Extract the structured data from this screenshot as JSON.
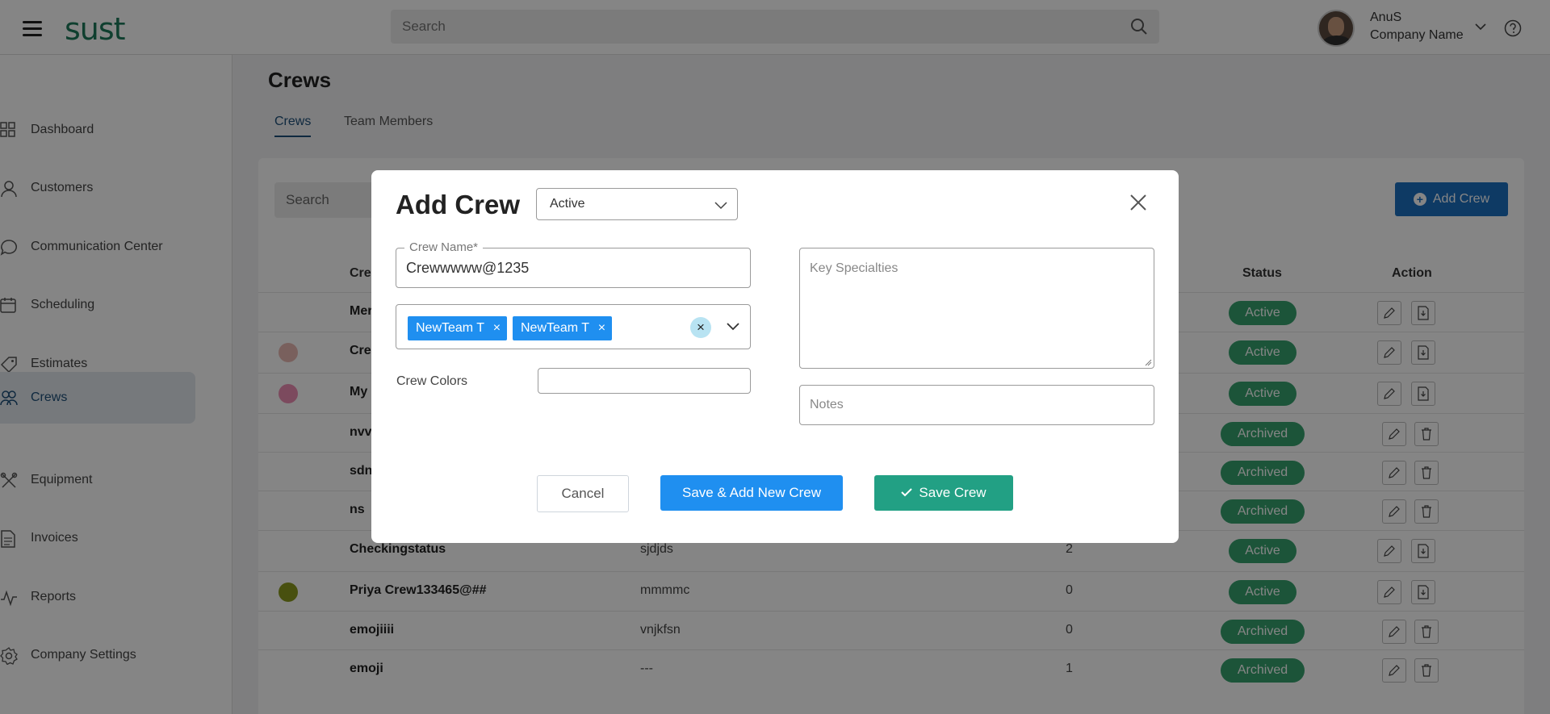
{
  "app": {
    "logo_text": "sust",
    "search_placeholder": "Search",
    "user_name": "AnuS",
    "company_name": "Company Name"
  },
  "sidebar": {
    "items": [
      {
        "label": "Dashboard",
        "icon": "dashboard-icon"
      },
      {
        "label": "Customers",
        "icon": "user-icon"
      },
      {
        "label": "Communication Center",
        "icon": "chat-icon"
      },
      {
        "label": "Scheduling",
        "icon": "calendar-icon"
      },
      {
        "label": "Estimates",
        "icon": "tag-icon"
      },
      {
        "label": "Crews",
        "icon": "crews-icon",
        "active": true
      },
      {
        "label": "Equipment",
        "icon": "tools-icon"
      },
      {
        "label": "Invoices",
        "icon": "document-icon"
      },
      {
        "label": "Reports",
        "icon": "chart-icon"
      },
      {
        "label": "Company Settings",
        "icon": "gear-icon"
      }
    ]
  },
  "main": {
    "title": "Crews",
    "tabs": [
      "Crews",
      "Team Members"
    ],
    "search_placeholder": "Search",
    "add_button_label": "Add Crew",
    "columns": {
      "name": "Cre",
      "status": "Status",
      "action": "Action"
    },
    "rows": [
      {
        "name": "Mer",
        "desc": "",
        "count": "",
        "status": "Active",
        "color": ""
      },
      {
        "name": "Cre",
        "desc": "",
        "count": "",
        "status": "Active",
        "color": "#e8b9b2"
      },
      {
        "name": "My",
        "desc": "",
        "count": "",
        "status": "Active",
        "color": "#ee8fb4"
      },
      {
        "name": "nvv",
        "desc": "",
        "count": "",
        "status": "Archived",
        "color": ""
      },
      {
        "name": "sdn",
        "desc": "",
        "count": "",
        "status": "Archived",
        "color": ""
      },
      {
        "name": "ns",
        "desc": "",
        "count": "",
        "status": "Archived",
        "color": ""
      },
      {
        "name": "Checkingstatus",
        "desc": "sjdjds",
        "count": "2",
        "status": "Active",
        "color": ""
      },
      {
        "name": "Priya Crew133465@##",
        "desc": "mmmmc",
        "count": "0",
        "status": "Active",
        "color": "#8a9a1e"
      },
      {
        "name": "emojiiii",
        "desc": "vnjkfsn",
        "count": "0",
        "status": "Archived",
        "color": ""
      },
      {
        "name": "emoji",
        "desc": "---",
        "count": "1",
        "status": "Archived",
        "color": ""
      }
    ]
  },
  "modal": {
    "title": "Add Crew",
    "status_value": "Active",
    "crew_name_label": "Crew Name*",
    "crew_name_value": "Crewwwww@1235",
    "team_chips": [
      "NewTeam T",
      "NewTeam T"
    ],
    "crew_colors_label": "Crew Colors",
    "key_specialties_placeholder": "Key Specialties",
    "notes_placeholder": "Notes",
    "cancel_label": "Cancel",
    "save_add_label": "Save & Add New Crew",
    "save_label": "Save Crew"
  }
}
